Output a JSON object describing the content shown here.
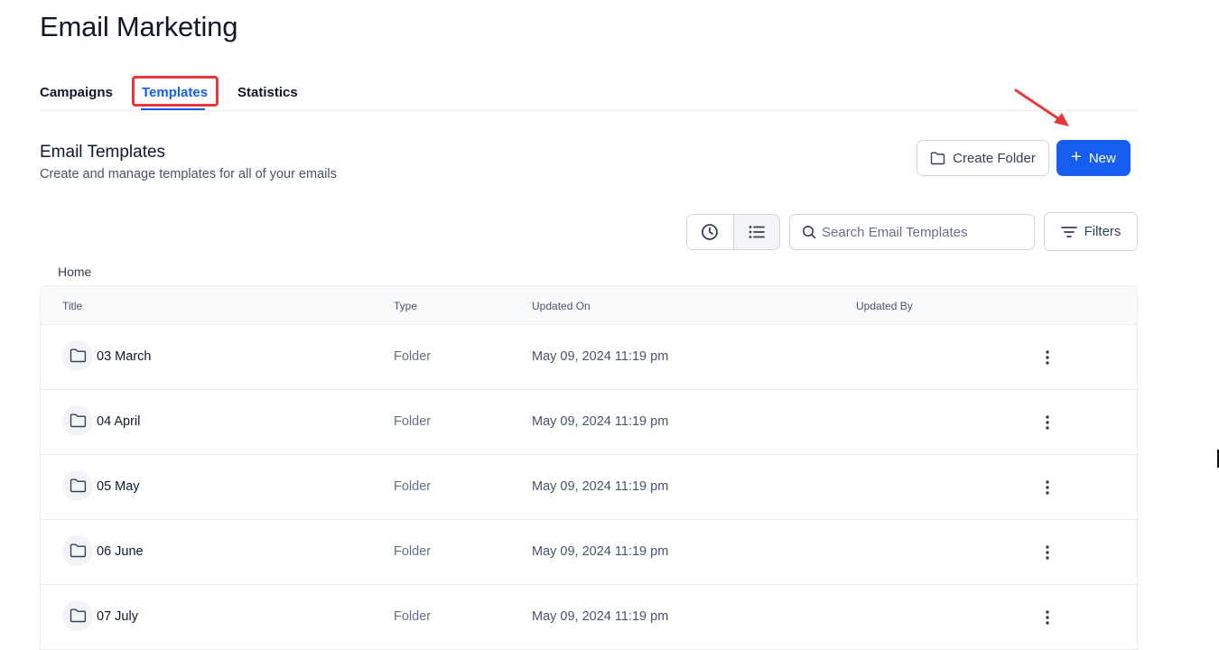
{
  "page": {
    "title": "Email Marketing"
  },
  "tabs": [
    {
      "label": "Campaigns"
    },
    {
      "label": "Templates",
      "active": true
    },
    {
      "label": "Statistics"
    }
  ],
  "section": {
    "title": "Email Templates",
    "subtitle": "Create and manage templates for all of your emails"
  },
  "actions": {
    "create_folder_label": "Create Folder",
    "new_label": "New"
  },
  "toolbar": {
    "search_placeholder": "Search Email Templates",
    "filters_label": "Filters"
  },
  "breadcrumb": {
    "home": "Home"
  },
  "table": {
    "headers": {
      "title": "Title",
      "type": "Type",
      "updated_on": "Updated On",
      "updated_by": "Updated By"
    },
    "rows": [
      {
        "title": "03 March",
        "type": "Folder",
        "updated_on": "May 09, 2024 11:19 pm",
        "updated_by": ""
      },
      {
        "title": "04 April",
        "type": "Folder",
        "updated_on": "May 09, 2024 11:19 pm",
        "updated_by": ""
      },
      {
        "title": "05 May",
        "type": "Folder",
        "updated_on": "May 09, 2024 11:19 pm",
        "updated_by": ""
      },
      {
        "title": "06 June",
        "type": "Folder",
        "updated_on": "May 09, 2024 11:19 pm",
        "updated_by": ""
      },
      {
        "title": "07 July",
        "type": "Folder",
        "updated_on": "May 09, 2024 11:19 pm",
        "updated_by": ""
      }
    ]
  },
  "colors": {
    "accent": "#155eef",
    "highlight": "#e5383b"
  },
  "icons": [
    "folder-icon",
    "plus-icon",
    "clock-icon",
    "list-icon",
    "search-icon",
    "filter-icon",
    "more-vertical-icon"
  ]
}
